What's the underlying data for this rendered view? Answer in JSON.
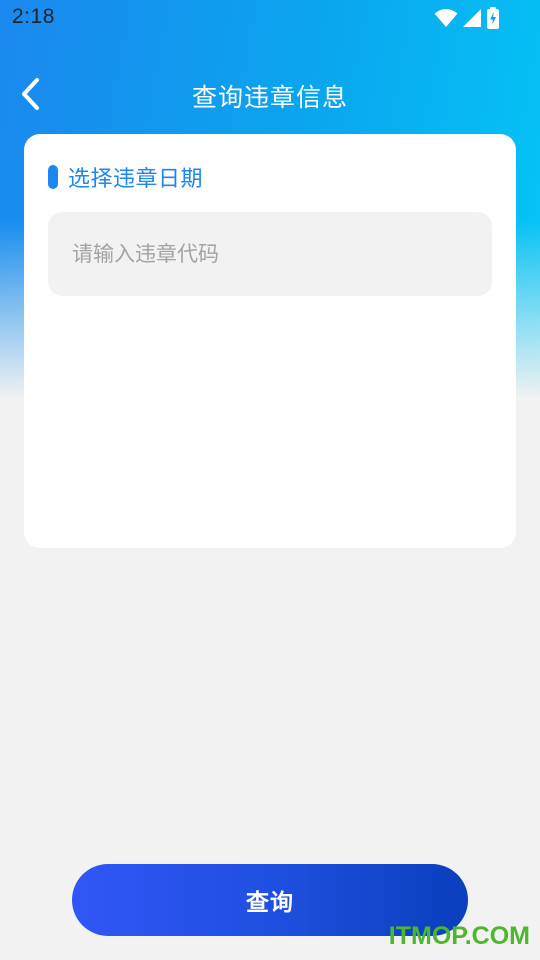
{
  "status_bar": {
    "time": "2:18",
    "icons": [
      "wifi-icon",
      "cellular-signal-icon",
      "battery-charging-icon"
    ]
  },
  "nav": {
    "back_icon": "chevron-left-icon",
    "title": "查询违章信息"
  },
  "card": {
    "section_title": "选择违章日期",
    "code_input": {
      "value": "",
      "placeholder": "请输入违章代码"
    }
  },
  "actions": {
    "query_label": "查询"
  },
  "watermark": {
    "text": "ITMOP.COM"
  },
  "colors": {
    "accent": "#1b88ef",
    "header_gradient_start": "#1b88ef",
    "header_gradient_end": "#05c6f6",
    "button_gradient_start": "#3156f7",
    "button_gradient_end": "#0a3fbd",
    "page_background": "#f2f2f2",
    "watermark": "#4db82a"
  }
}
